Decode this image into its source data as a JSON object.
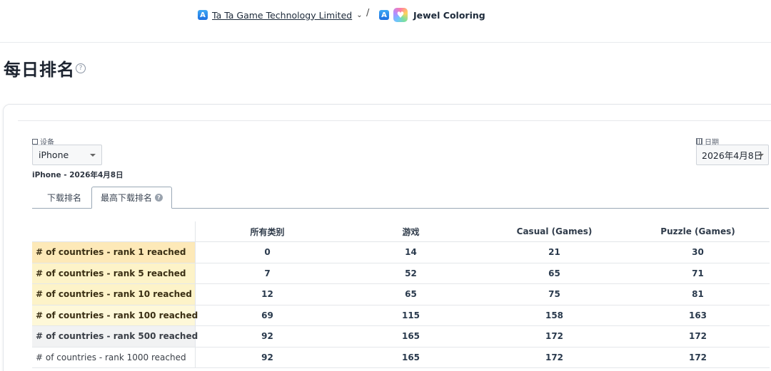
{
  "breadcrumb": {
    "developer": "Ta Ta Game Technology Limited",
    "separator": "/",
    "app": "Jewel Coloring"
  },
  "page": {
    "title": "每日排名",
    "help_glyph": "?"
  },
  "filters": {
    "device_label": "设备",
    "device_value": "iPhone",
    "date_label": "日期",
    "date_value": "2026年4月8日"
  },
  "subtitle": "iPhone - 2026年4月8日",
  "tabs": [
    {
      "label": "下载排名",
      "active": false
    },
    {
      "label": "最高下载排名",
      "active": true
    }
  ],
  "table": {
    "columns": [
      "",
      "所有类别",
      "游戏",
      "Casual (Games)",
      "Puzzle (Games)"
    ],
    "rows": [
      {
        "label": "# of countries - rank 1 reached",
        "values": [
          "0",
          "14",
          "21",
          "30"
        ],
        "color": "#fde9b8"
      },
      {
        "label": "# of countries - rank 5 reached",
        "values": [
          "7",
          "52",
          "65",
          "71"
        ],
        "color": "#fdf3c8"
      },
      {
        "label": "# of countries - rank 10 reached",
        "values": [
          "12",
          "65",
          "75",
          "81"
        ],
        "color": "#fdf3c8"
      },
      {
        "label": "# of countries - rank 100 reached",
        "values": [
          "69",
          "115",
          "158",
          "163"
        ],
        "color": "#fef8d8"
      },
      {
        "label": "# of countries - rank 500 reached",
        "values": [
          "92",
          "165",
          "172",
          "172"
        ],
        "color": "#f1f2f3"
      },
      {
        "label": "# of countries - rank 1000 reached",
        "values": [
          "92",
          "165",
          "172",
          "172"
        ],
        "color": "#ffffff"
      }
    ]
  },
  "colors": {
    "accent": "#1d6fe0",
    "tab_border": "#9aa8b6",
    "text_dark": "#2a3a4d"
  },
  "icons": {
    "appstore": "app-store-icon",
    "chevron": "chevron-down-icon",
    "help": "help-circle-icon",
    "device": "device-icon",
    "calendar": "calendar-icon"
  }
}
